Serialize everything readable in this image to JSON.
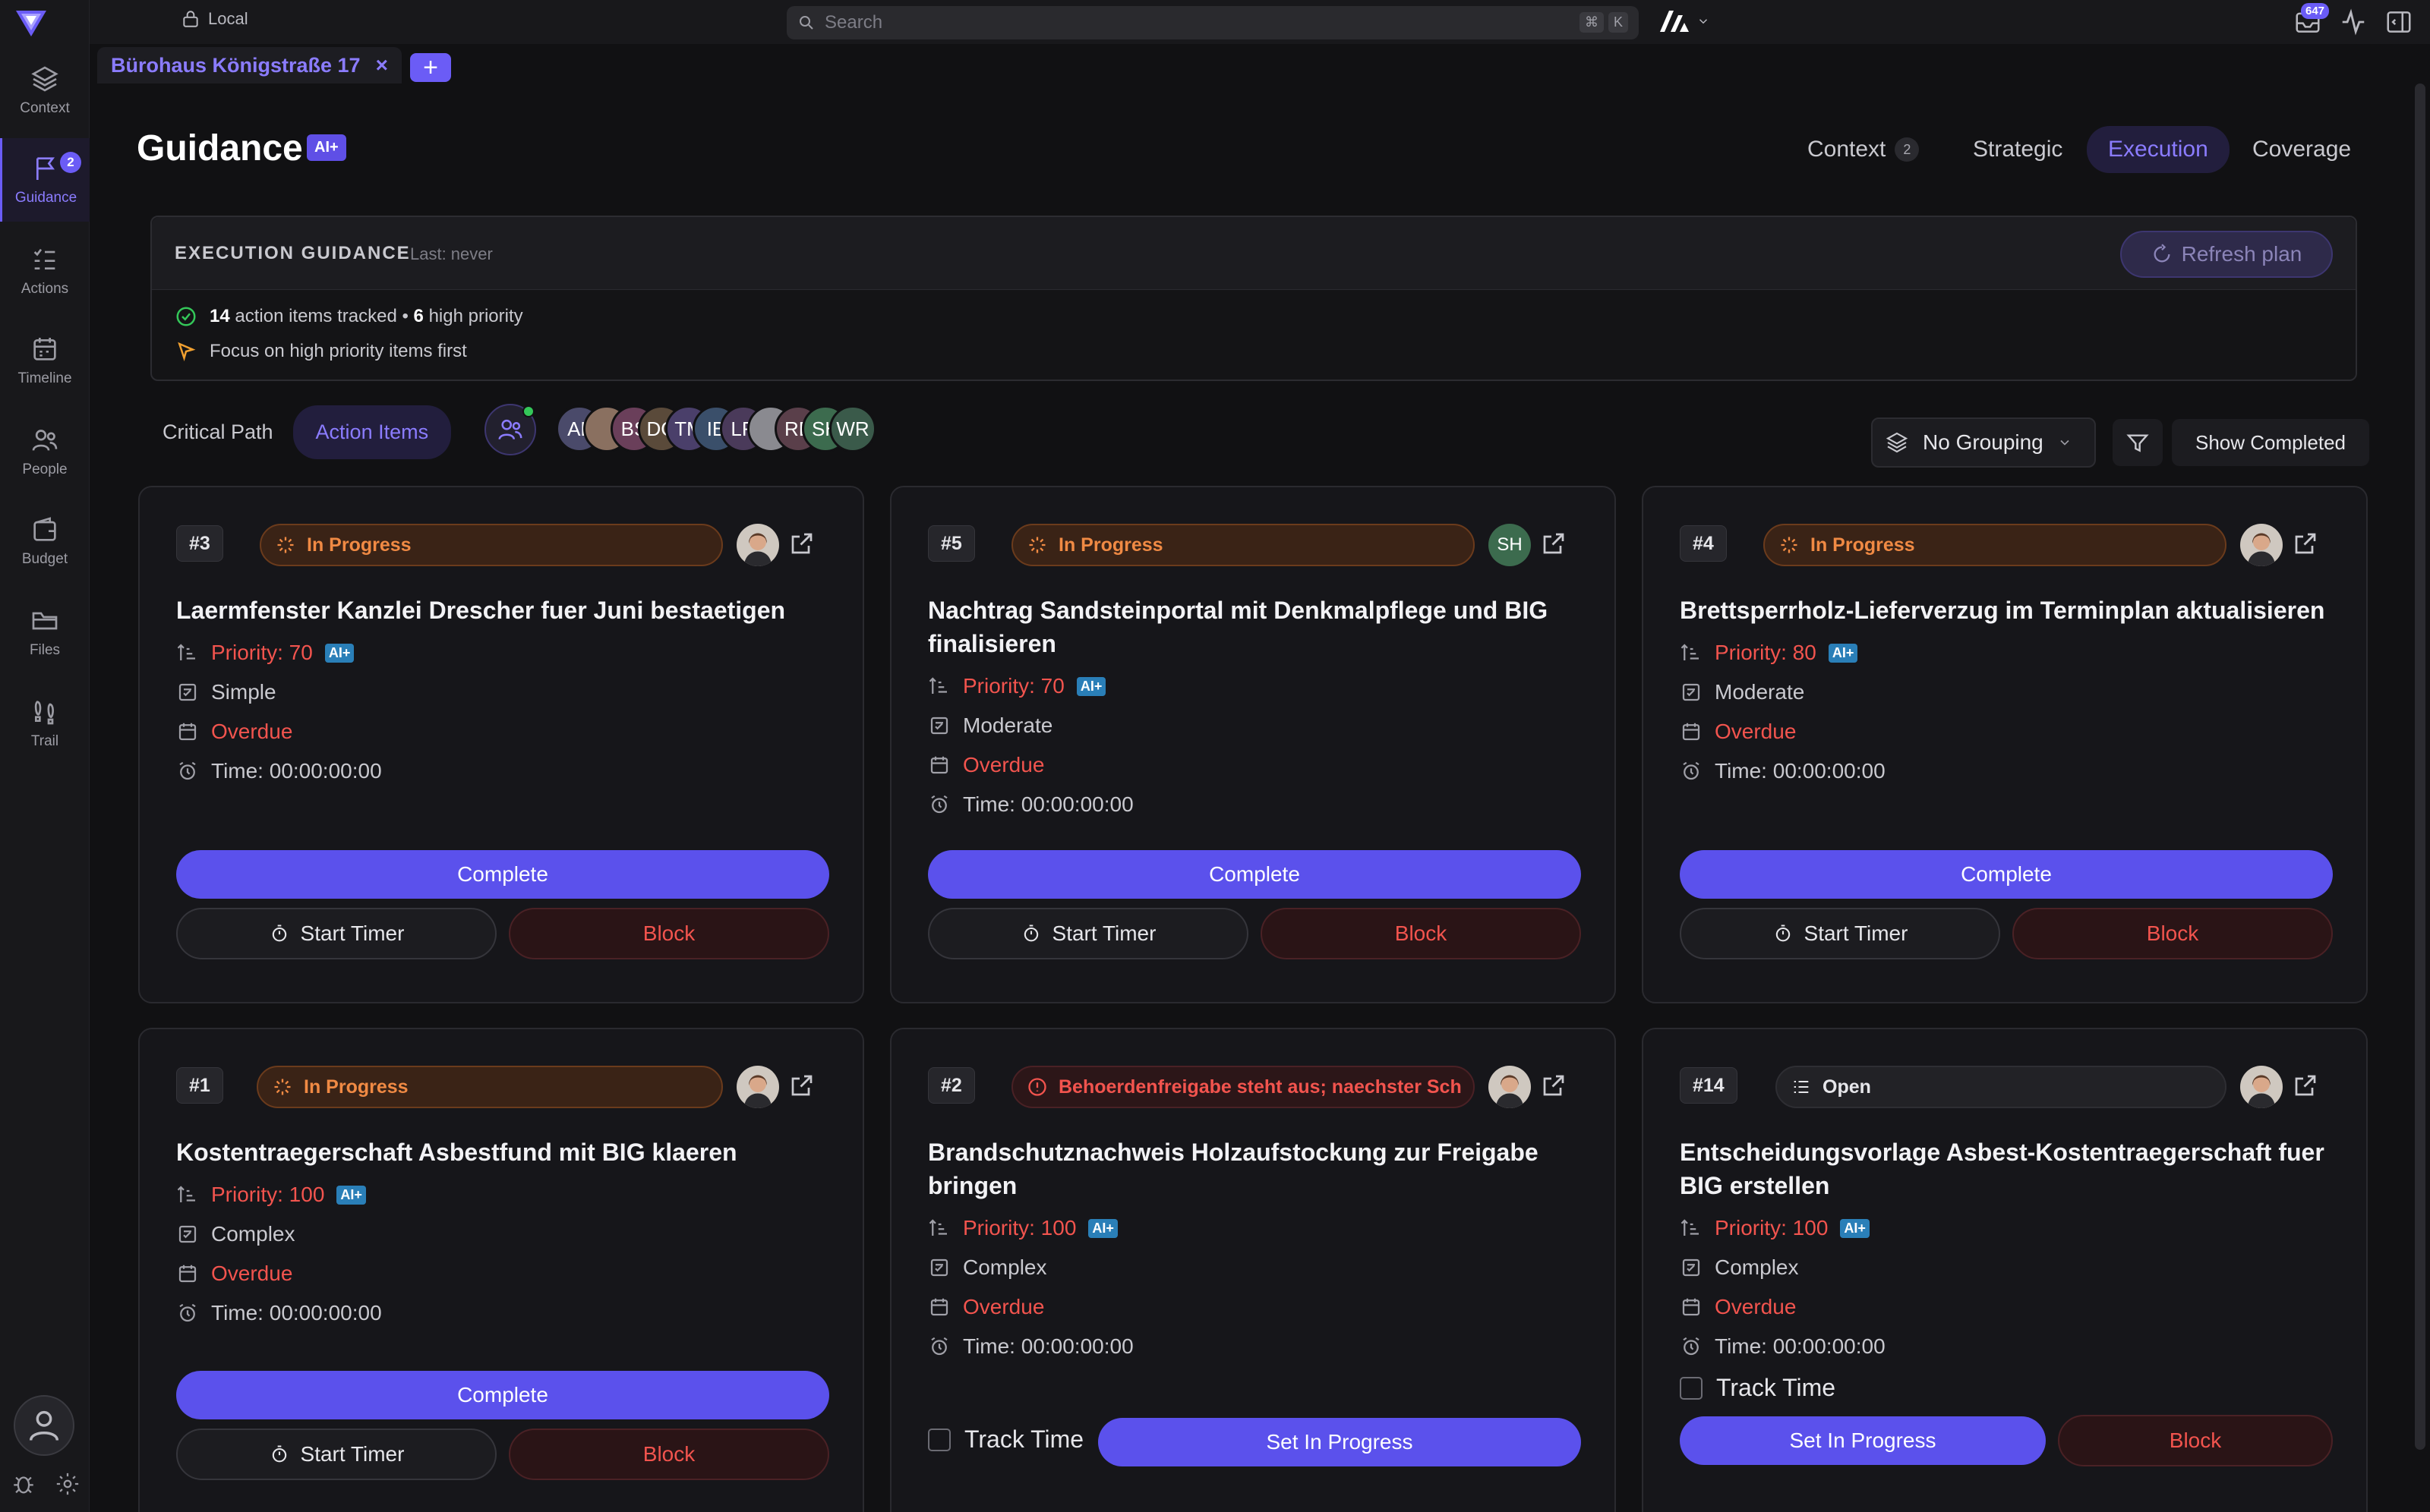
{
  "workspace": {
    "label": "Local"
  },
  "search": {
    "placeholder": "Search",
    "shortcut": [
      "⌘",
      "K"
    ]
  },
  "topbar": {
    "notification_count": "647"
  },
  "sidebar": {
    "items": [
      {
        "label": "Context",
        "icon": "layers-icon"
      },
      {
        "label": "Guidance",
        "icon": "flag-icon",
        "badge": "2"
      },
      {
        "label": "Actions",
        "icon": "list-check-icon"
      },
      {
        "label": "Timeline",
        "icon": "calendar-icon"
      },
      {
        "label": "People",
        "icon": "people-icon"
      },
      {
        "label": "Budget",
        "icon": "wallet-icon"
      },
      {
        "label": "Files",
        "icon": "folder-icon"
      },
      {
        "label": "Trail",
        "icon": "footprints-icon"
      }
    ]
  },
  "tab": {
    "label": "Bürohaus Königstraße 17",
    "close": "×",
    "add": "+"
  },
  "page": {
    "title": "Guidance",
    "ai_tag": "AI+"
  },
  "top_tabs": {
    "context": {
      "label": "Context",
      "count": "2"
    },
    "strategic": "Strategic",
    "execution": "Execution",
    "coverage": "Coverage"
  },
  "guidance_box": {
    "title": "EXECUTION GUIDANCE",
    "last": "Last: never",
    "refresh": "Refresh plan",
    "tracked_count": "14",
    "tracked_text": "action items tracked •",
    "high_count": "6",
    "high_text": "high priority",
    "focus": "Focus on high priority items first"
  },
  "view_toggle": {
    "critical_path": "Critical Path",
    "action_items": "Action Items"
  },
  "team_avatars": [
    {
      "initials": "AL",
      "color": "#4a4a6a"
    },
    {
      "initials": "",
      "color": "#8a7060"
    },
    {
      "initials": "BS",
      "color": "#6a3f5a"
    },
    {
      "initials": "DG",
      "color": "#5a4a3a"
    },
    {
      "initials": "TM",
      "color": "#4a3f6a"
    },
    {
      "initials": "IB",
      "color": "#3a4f6a"
    },
    {
      "initials": "LR",
      "color": "#4a3a5a"
    },
    {
      "initials": "",
      "color": "#8a8a90"
    },
    {
      "initials": "RB",
      "color": "#5a3f4a"
    },
    {
      "initials": "SH",
      "color": "#3c6b4e"
    },
    {
      "initials": "WR",
      "color": "#3a5a4a"
    }
  ],
  "controls": {
    "grouping": "No Grouping",
    "show_completed": "Show Completed"
  },
  "colors": {
    "accent": "#5b51ec",
    "danger": "#f2544e",
    "in_progress": "#f08a44"
  },
  "cards": [
    {
      "id": "#3",
      "status": "In Progress",
      "assignee": "photo",
      "title": "Laermfenster Kanzlei Drescher fuer Juni bestaetigen",
      "priority": "Priority: 70",
      "complexity": "Simple",
      "due": "Overdue",
      "time": "Time: 00:00:00:00",
      "complete": "Complete",
      "timer": "Start Timer",
      "block": "Block"
    },
    {
      "id": "#5",
      "status": "In Progress",
      "assignee": "SH",
      "title": "Nachtrag Sandsteinportal mit Denkmalpflege und BIG finalisieren",
      "priority": "Priority: 70",
      "complexity": "Moderate",
      "due": "Overdue",
      "time": "Time: 00:00:00:00",
      "complete": "Complete",
      "timer": "Start Timer",
      "block": "Block"
    },
    {
      "id": "#4",
      "status": "In Progress",
      "assignee": "photo",
      "title": "Brettsperrholz-Lieferverzug im Terminplan aktualisieren",
      "priority": "Priority: 80",
      "complexity": "Moderate",
      "due": "Overdue",
      "time": "Time: 00:00:00:00",
      "complete": "Complete",
      "timer": "Start Timer",
      "block": "Block"
    },
    {
      "id": "#1",
      "status": "In Progress",
      "assignee": "photo",
      "title": "Kostentraegerschaft Asbestfund mit BIG klaeren",
      "priority": "Priority: 100",
      "complexity": "Complex",
      "due": "Overdue",
      "time": "Time: 00:00:00:00",
      "complete": "Complete",
      "timer": "Start Timer",
      "block": "Block"
    },
    {
      "id": "#2",
      "status": "Behoerdenfreigabe steht aus; naechster Sch",
      "assignee": "photo",
      "title": "Brandschutznachweis Holzaufstockung zur Freigabe bringen",
      "priority": "Priority: 100",
      "complexity": "Complex",
      "due": "Overdue",
      "time": "Time: 00:00:00:00",
      "track": "Track Time",
      "set_progress": "Set In Progress"
    },
    {
      "id": "#14",
      "status": "Open",
      "assignee": "photo",
      "title": "Entscheidungsvorlage Asbest-Kostentraegerschaft fuer BIG erstellen",
      "priority": "Priority: 100",
      "complexity": "Complex",
      "due": "Overdue",
      "time": "Time: 00:00:00:00",
      "track": "Track Time",
      "set_progress": "Set In Progress",
      "block": "Block"
    }
  ],
  "ai_mini": "AI+"
}
